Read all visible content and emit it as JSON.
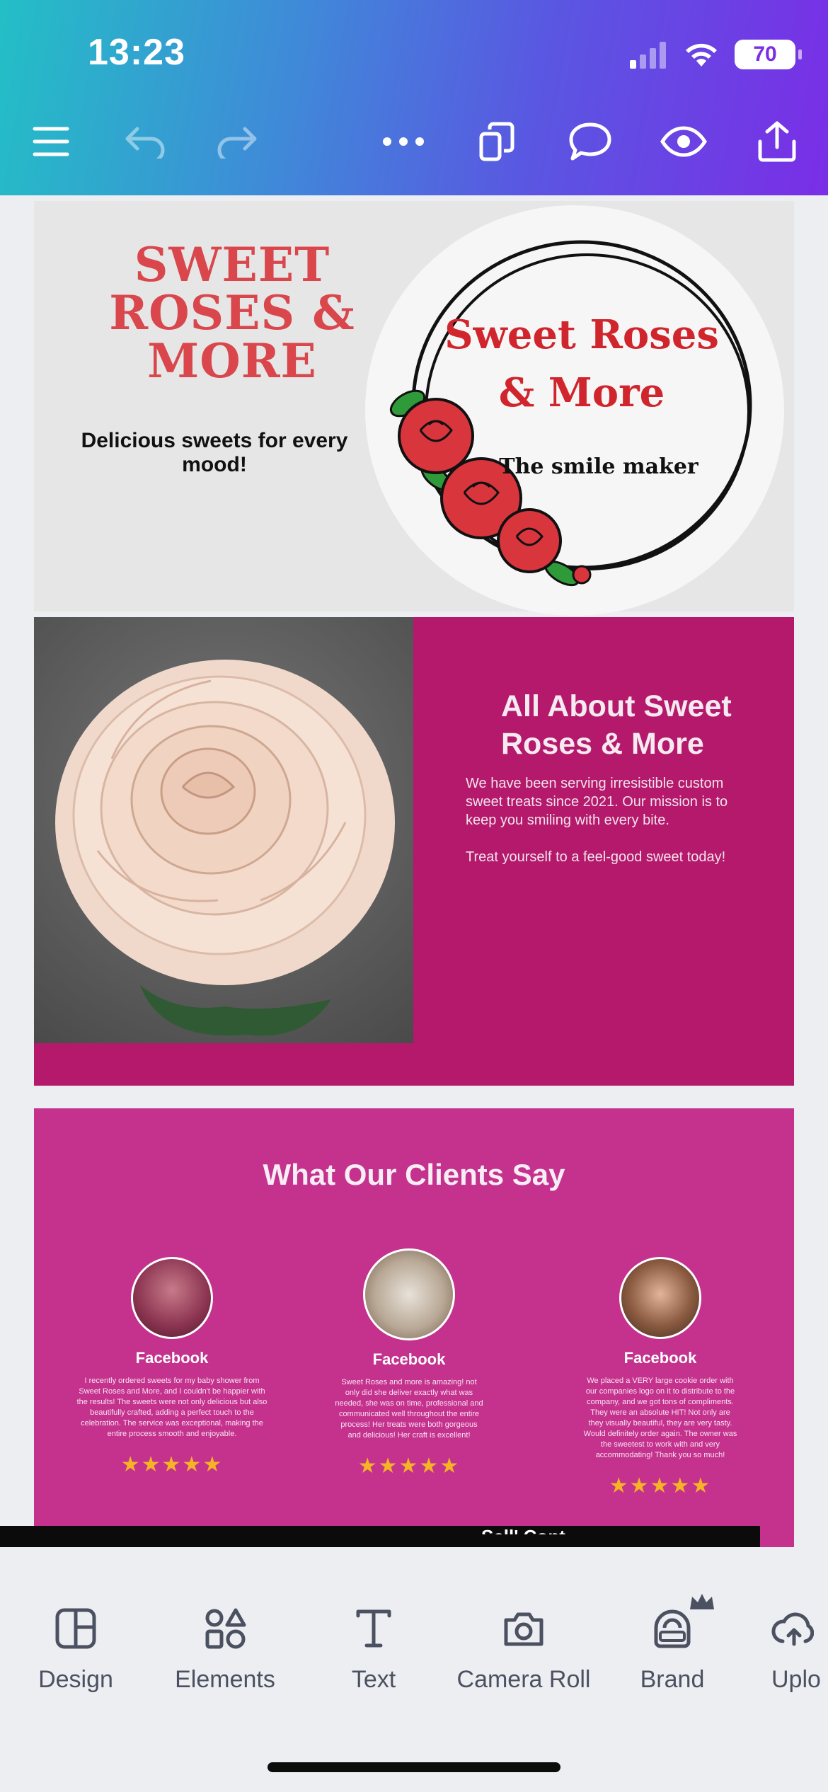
{
  "status_bar": {
    "time": "13:23",
    "battery": "70"
  },
  "toolbar": {
    "menu_icon": "hamburger-menu-icon",
    "undo_icon": "undo-icon",
    "redo_icon": "redo-icon",
    "more_icon": "more-dots-icon",
    "pages_icon": "pages-icon",
    "comment_icon": "comment-icon",
    "preview_icon": "eye-icon",
    "share_icon": "share-icon"
  },
  "page1": {
    "title": "SWEET ROSES & MORE",
    "tagline": "Delicious sweets for every mood!",
    "logo_title_line1": "Sweet Roses",
    "logo_title_line2": "& More",
    "logo_subtitle": "The smile maker"
  },
  "page2": {
    "heading": "All About Sweet Roses & More",
    "body": "We have been serving irresistible custom sweet treats since 2021. Our mission is to keep you smiling with every bite.",
    "body2": "Treat yourself to a feel-good sweet today!"
  },
  "page3": {
    "title": "What Our Clients Say",
    "testimonials": [
      {
        "source": "Facebook",
        "text": "I recently ordered sweets for my baby shower from Sweet Roses and More, and I couldn't be happier with the results! The sweets were not only delicious but also beautifully crafted, adding a perfect touch to the celebration. The service was exceptional, making the entire process smooth and enjoyable.",
        "stars": "★★★★★"
      },
      {
        "source": "Facebook",
        "text": "Sweet Roses and more is amazing! not only did she deliver exactly what was needed, she was on time, professional and communicated well throughout the entire process! Her treats were both gorgeous and delicious! Her craft is excellent!",
        "stars": "★★★★★"
      },
      {
        "source": "Facebook",
        "text": "We placed a VERY large cookie order with our companies logo on it to distribute to the company, and we got tons of compliments. They were an absolute HIT! Not only are they visually beautiful, they are very tasty. Would definitely order again. The owner was the sweetest to work with and very accommodating! Thank you so much!",
        "stars": "★★★★★"
      }
    ],
    "strip_text": "Sell' Cont…"
  },
  "bottom_toolbar": {
    "items": [
      {
        "label": "Design",
        "icon": "layout-icon"
      },
      {
        "label": "Elements",
        "icon": "shapes-icon"
      },
      {
        "label": "Text",
        "icon": "text-icon"
      },
      {
        "label": "Camera Roll",
        "icon": "camera-icon"
      },
      {
        "label": "Brand",
        "icon": "brand-icon"
      },
      {
        "label": "Uplo",
        "icon": "upload-icon"
      }
    ]
  },
  "colors": {
    "accent_red": "#d9474d",
    "magenta": "#b4196c",
    "pink": "#c4328e",
    "star": "#f5b325"
  }
}
